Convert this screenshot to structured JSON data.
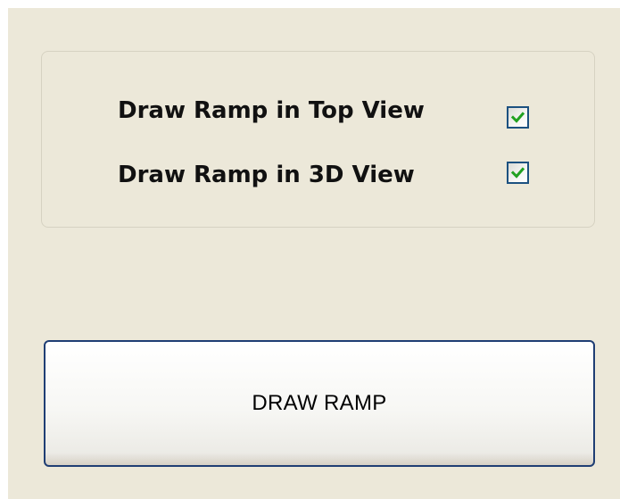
{
  "options_group": {
    "top_view": {
      "label": "Draw Ramp in Top View",
      "checked": true
    },
    "view_3d": {
      "label": "Draw Ramp in 3D View",
      "checked": true
    }
  },
  "actions": {
    "draw_ramp_label": "DRAW RAMP"
  },
  "colors": {
    "panel_background": "#ece8d9",
    "checkmark": "#21a121",
    "checkbox_border": "#1c5180",
    "button_border": "#1f3e74"
  }
}
